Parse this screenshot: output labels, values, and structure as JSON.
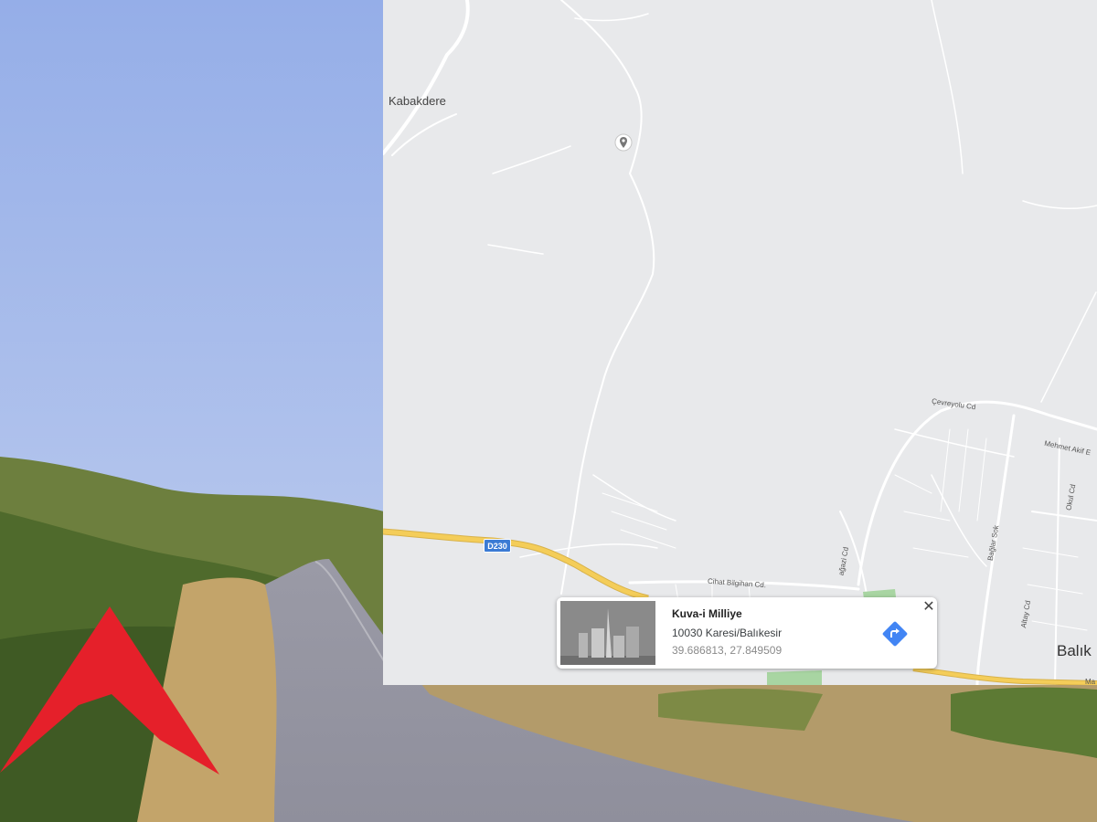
{
  "map": {
    "town_label": "Kabakdere",
    "city_label": "Balık",
    "road_shield": "D230",
    "streets": [
      "Çevreyolu Cd",
      "Mehmet Akif E",
      "Cihat Bilgihan Cd.",
      "Bağlar Sok",
      "Okul Cd",
      "Altay Cd",
      "ağazi Cd",
      "Ma"
    ]
  },
  "info_card": {
    "title": "Kuva-i Milliye",
    "address": "10030 Karesi/Balıkesir",
    "coordinates": "39.686813, 27.849509",
    "close_symbol": "✕"
  },
  "icons": {
    "pin": "map-pin-icon",
    "directions": "directions-icon",
    "logo": "red-a-logo-icon"
  },
  "colors": {
    "logo_red": "#e5202a",
    "directions_blue": "#4285f4",
    "highway_yellow": "#f4cd59",
    "shield_blue": "#3b7bd4"
  }
}
